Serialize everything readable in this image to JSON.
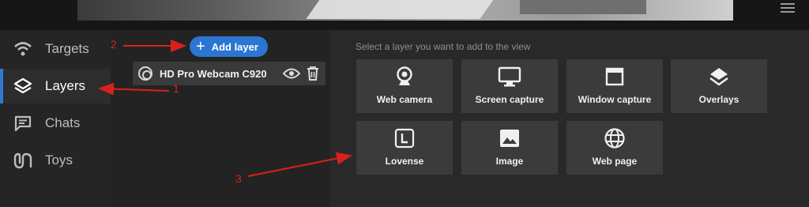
{
  "sidebar": {
    "items": [
      {
        "label": "Targets",
        "icon": "wifi-icon",
        "active": false
      },
      {
        "label": "Layers",
        "icon": "layers-icon",
        "active": true
      },
      {
        "label": "Chats",
        "icon": "chat-icon",
        "active": false
      },
      {
        "label": "Toys",
        "icon": "toy-icon",
        "active": false
      }
    ]
  },
  "layers": {
    "add_label": "Add layer",
    "items": [
      {
        "name": "HD Pro Webcam C920"
      }
    ]
  },
  "add_panel": {
    "hint": "Select a layer you want to add to the view",
    "tiles": [
      {
        "label": "Web camera",
        "icon": "webcam-icon"
      },
      {
        "label": "Screen capture",
        "icon": "monitor-icon"
      },
      {
        "label": "Window capture",
        "icon": "window-icon"
      },
      {
        "label": "Overlays",
        "icon": "overlays-icon"
      },
      {
        "label": "Lovense",
        "icon": "lovense-icon"
      },
      {
        "label": "Image",
        "icon": "image-icon"
      },
      {
        "label": "Web page",
        "icon": "globe-icon"
      }
    ]
  },
  "annotations": {
    "one": "1",
    "two": "2",
    "three": "3"
  },
  "colors": {
    "accent": "#2a76d2",
    "annotation": "#d8211c",
    "active_indicator": "#2f7bd1"
  }
}
